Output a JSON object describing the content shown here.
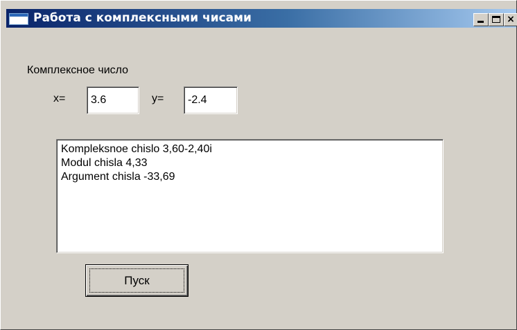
{
  "window": {
    "title": "Работа с комплексными чисами",
    "controls": {
      "minimize": "",
      "maximize": "",
      "close": "×"
    }
  },
  "form": {
    "group_label": "Комплексное число",
    "x_label": "x=",
    "x_value": "3.6",
    "y_label": "y=",
    "y_value": "-2.4"
  },
  "memo": {
    "lines": [
      "Kompleksnoe chislo 3,60-2,40i",
      "Modul chisla 4,33",
      "Argument chisla -33,69"
    ]
  },
  "run_button": {
    "label": "Пуск"
  }
}
